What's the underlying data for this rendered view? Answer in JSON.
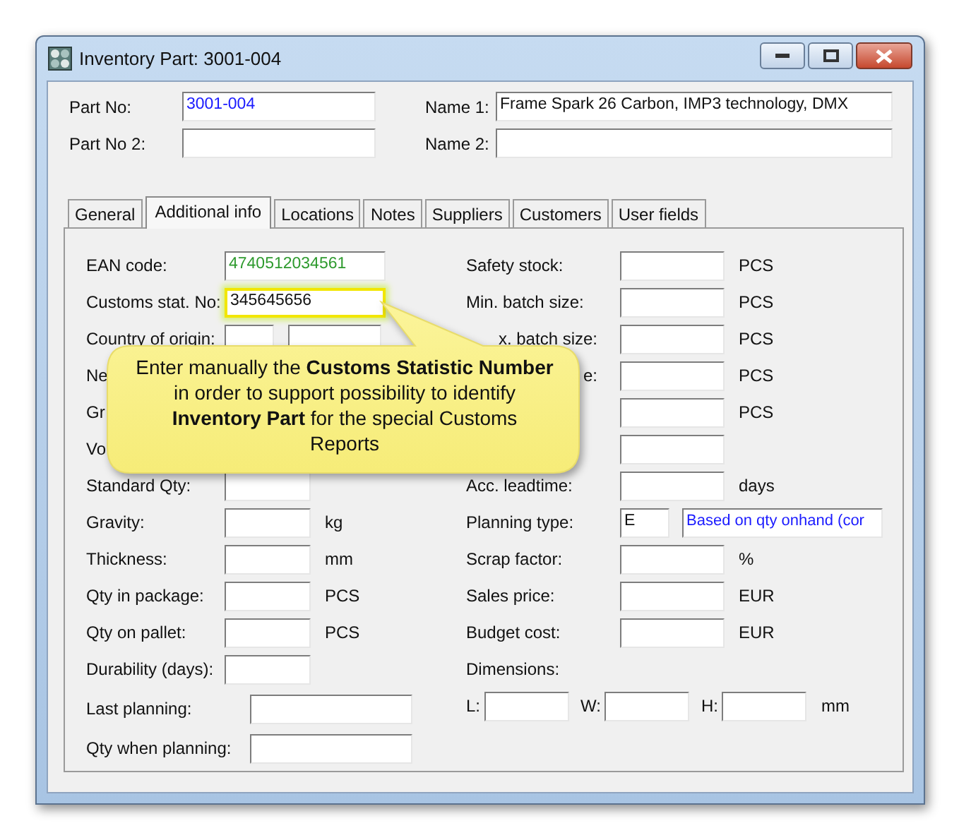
{
  "window": {
    "title": "Inventory Part: 3001-004"
  },
  "header": [
    {
      "label": "Part No:",
      "value": "3001-004",
      "color": "#1a1aff"
    },
    {
      "label": "Name 1:",
      "value": "Frame Spark 26 Carbon, IMP3 technology, DMX"
    },
    {
      "label": "Part No 2:"
    },
    {
      "label": "Name 2:"
    }
  ],
  "tabs": [
    {
      "label": "General",
      "selected": false
    },
    {
      "label": "Additional info",
      "selected": true
    },
    {
      "label": "Locations",
      "selected": false
    },
    {
      "label": "Notes",
      "selected": false
    },
    {
      "label": "Suppliers",
      "selected": false
    },
    {
      "label": "Customers",
      "selected": false
    },
    {
      "label": "User fields",
      "selected": false
    }
  ],
  "left_rows": [
    {
      "kind": "long",
      "label": "EAN code:",
      "value": "4740512034561",
      "color": "#2e9a2e"
    },
    {
      "kind": "long",
      "label": "Customs stat. No:",
      "value": "345645656",
      "highlighted": true
    },
    {
      "kind": "pair",
      "label": "Country of origin:",
      "fields": [
        {
          "kind": "short"
        },
        {
          "kind": "long"
        }
      ]
    },
    {
      "kind": "label",
      "label": "Ne"
    },
    {
      "kind": "label",
      "label": "Gr"
    },
    {
      "kind": "label",
      "label": "Vo"
    },
    {
      "kind": "field",
      "label": "Standard Qty:"
    },
    {
      "kind": "field",
      "label": "Gravity:",
      "unit": "kg"
    },
    {
      "kind": "field",
      "label": "Thickness:",
      "unit": "mm"
    },
    {
      "kind": "field",
      "label": "Qty in package:",
      "unit": "PCS"
    },
    {
      "kind": "field",
      "label": "Qty on pallet:",
      "unit": "PCS"
    },
    {
      "kind": "field",
      "label": "Durability (days):"
    },
    {
      "kind": "wide",
      "label": "Last planning:"
    },
    {
      "kind": "wide",
      "label": "Qty when planning:"
    }
  ],
  "right_rows": [
    {
      "kind": "field",
      "label": "Safety stock:",
      "unit": "PCS"
    },
    {
      "kind": "field",
      "label": "Min. batch size:",
      "unit": "PCS"
    },
    {
      "kind": "field",
      "label": "x. batch size:",
      "clipped_start": true,
      "unit": "PCS"
    },
    {
      "kind": "field",
      "label": "e:",
      "clipped_start": true,
      "unit": "PCS"
    },
    {
      "kind": "field",
      "unit": "PCS"
    },
    {
      "kind": "field"
    },
    {
      "kind": "field",
      "label": "Acc. leadtime:",
      "unit": "days"
    },
    {
      "kind": "pair",
      "label": "Planning type:",
      "fields": [
        {
          "kind": "short",
          "value": "E"
        },
        {
          "kind": "long",
          "value": "Based on qty onhand (cor",
          "color": "#1a1aff"
        }
      ]
    },
    {
      "kind": "field",
      "label": "Scrap factor:",
      "unit": "%"
    },
    {
      "kind": "field",
      "label": "Sales price:",
      "unit": "EUR"
    },
    {
      "kind": "field",
      "label": "Budget cost:",
      "unit": "EUR"
    },
    {
      "kind": "label",
      "label": "Dimensions:"
    },
    {
      "kind": "dims",
      "parts": [
        {
          "label": "L:"
        },
        {
          "label": "W:"
        },
        {
          "label": "H:"
        }
      ],
      "unit": "mm"
    }
  ],
  "callout": {
    "text": "Enter manually the **Customs Statistic Number** in order to support possibility to identify **Inventory Part** for the special Customs Reports"
  }
}
